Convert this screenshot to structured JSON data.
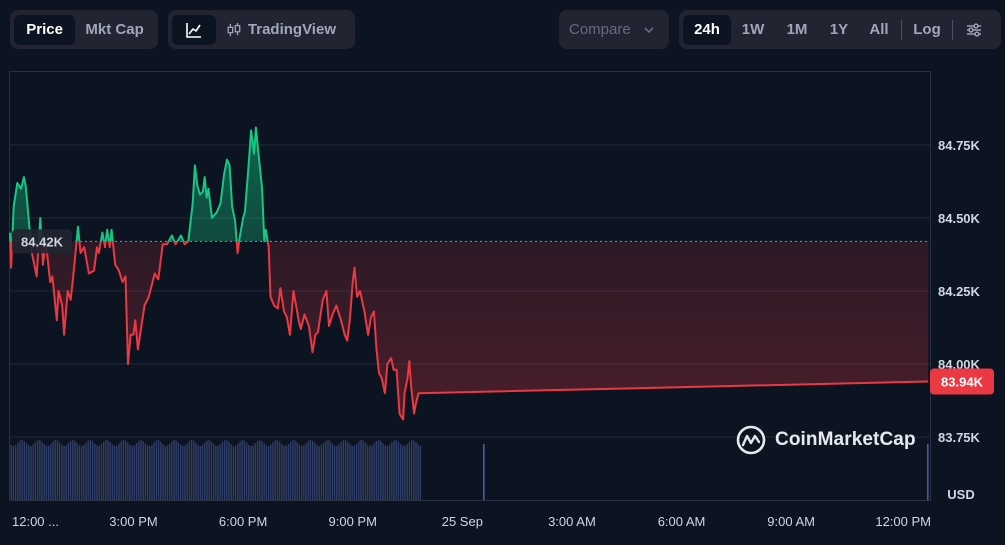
{
  "toolbar": {
    "metric_tabs": [
      {
        "label": "Price",
        "active": true
      },
      {
        "label": "Mkt Cap",
        "active": false
      }
    ],
    "view_tabs": {
      "line_icon": "line-chart-icon",
      "candles_icon": "candlestick-icon",
      "tradingview_label": "TradingView"
    },
    "compare_label": "Compare",
    "range_tabs": [
      {
        "label": "24h",
        "active": true
      },
      {
        "label": "1W",
        "active": false
      },
      {
        "label": "1M",
        "active": false
      },
      {
        "label": "1Y",
        "active": false
      },
      {
        "label": "All",
        "active": false
      }
    ],
    "log_label": "Log",
    "settings_icon": "sliders-icon"
  },
  "chart_data": {
    "type": "line",
    "reference_value": 84420,
    "reference_label": "84.42K",
    "last_value": 83940,
    "last_label": "83.94K",
    "currency_label": "USD",
    "y_ticks": [
      {
        "value": 84750,
        "label": "84.75K"
      },
      {
        "value": 84500,
        "label": "84.50K"
      },
      {
        "value": 84250,
        "label": "84.25K"
      },
      {
        "value": 84000,
        "label": "84.00K"
      },
      {
        "value": 83750,
        "label": "83.75K"
      }
    ],
    "ylim": [
      83750,
      85000
    ],
    "x_ticks": [
      {
        "t": 11.9,
        "label": "12:00 ..."
      },
      {
        "t": 15,
        "label": "3:00 PM"
      },
      {
        "t": 18,
        "label": "6:00 PM"
      },
      {
        "t": 21,
        "label": "9:00 PM"
      },
      {
        "t": 24,
        "label": "25 Sep"
      },
      {
        "t": 27,
        "label": "3:00 AM"
      },
      {
        "t": 30,
        "label": "6:00 AM"
      },
      {
        "t": 33,
        "label": "9:00 AM"
      },
      {
        "t": 36,
        "label": "12:00 PM"
      }
    ],
    "xlim": [
      11.62,
      36.8
    ],
    "up_color": "#16c784",
    "down_color": "#ea3943",
    "points": [
      [
        11.62,
        84450
      ],
      [
        11.65,
        84330
      ],
      [
        11.72,
        84540
      ],
      [
        11.82,
        84620
      ],
      [
        11.92,
        84600
      ],
      [
        12.0,
        84640
      ],
      [
        12.05,
        84610
      ],
      [
        12.15,
        84470
      ],
      [
        12.22,
        84380
      ],
      [
        12.35,
        84300
      ],
      [
        12.45,
        84500
      ],
      [
        12.52,
        84340
      ],
      [
        12.6,
        84420
      ],
      [
        12.72,
        84280
      ],
      [
        12.78,
        84300
      ],
      [
        12.9,
        84150
      ],
      [
        12.95,
        84250
      ],
      [
        13.05,
        84200
      ],
      [
        13.1,
        84100
      ],
      [
        13.2,
        84250
      ],
      [
        13.28,
        84220
      ],
      [
        13.35,
        84300
      ],
      [
        13.48,
        84470
      ],
      [
        13.55,
        84380
      ],
      [
        13.65,
        84400
      ],
      [
        13.78,
        84310
      ],
      [
        13.92,
        84320
      ],
      [
        14.0,
        84400
      ],
      [
        14.05,
        84380
      ],
      [
        14.15,
        84450
      ],
      [
        14.22,
        84400
      ],
      [
        14.28,
        84460
      ],
      [
        14.35,
        84400
      ],
      [
        14.4,
        84460
      ],
      [
        14.5,
        84340
      ],
      [
        14.6,
        84320
      ],
      [
        14.7,
        84280
      ],
      [
        14.78,
        84300
      ],
      [
        14.85,
        84000
      ],
      [
        14.92,
        84100
      ],
      [
        15.0,
        84100
      ],
      [
        15.05,
        84150
      ],
      [
        15.12,
        84050
      ],
      [
        15.18,
        84100
      ],
      [
        15.3,
        84200
      ],
      [
        15.42,
        84230
      ],
      [
        15.58,
        84310
      ],
      [
        15.68,
        84290
      ],
      [
        15.8,
        84410
      ],
      [
        15.92,
        84410
      ],
      [
        16.05,
        84440
      ],
      [
        16.15,
        84410
      ],
      [
        16.3,
        84440
      ],
      [
        16.4,
        84410
      ],
      [
        16.5,
        84420
      ],
      [
        16.62,
        84550
      ],
      [
        16.68,
        84680
      ],
      [
        16.75,
        84610
      ],
      [
        16.82,
        84580
      ],
      [
        16.9,
        84590
      ],
      [
        16.95,
        84640
      ],
      [
        17.0,
        84570
      ],
      [
        17.05,
        84600
      ],
      [
        17.15,
        84500
      ],
      [
        17.28,
        84520
      ],
      [
        17.38,
        84550
      ],
      [
        17.48,
        84650
      ],
      [
        17.56,
        84700
      ],
      [
        17.63,
        84680
      ],
      [
        17.7,
        84540
      ],
      [
        17.78,
        84490
      ],
      [
        17.85,
        84380
      ],
      [
        17.9,
        84430
      ],
      [
        18.0,
        84500
      ],
      [
        18.05,
        84520
      ],
      [
        18.15,
        84680
      ],
      [
        18.22,
        84800
      ],
      [
        18.3,
        84720
      ],
      [
        18.35,
        84810
      ],
      [
        18.42,
        84720
      ],
      [
        18.52,
        84600
      ],
      [
        18.58,
        84420
      ],
      [
        18.62,
        84460
      ],
      [
        18.7,
        84400
      ],
      [
        18.75,
        84230
      ],
      [
        18.85,
        84200
      ],
      [
        18.95,
        84190
      ],
      [
        19.02,
        84260
      ],
      [
        19.12,
        84180
      ],
      [
        19.2,
        84160
      ],
      [
        19.28,
        84100
      ],
      [
        19.38,
        84250
      ],
      [
        19.45,
        84200
      ],
      [
        19.52,
        84150
      ],
      [
        19.58,
        84120
      ],
      [
        19.68,
        84170
      ],
      [
        19.8,
        84130
      ],
      [
        19.9,
        84040
      ],
      [
        19.98,
        84100
      ],
      [
        20.05,
        84110
      ],
      [
        20.18,
        84220
      ],
      [
        20.28,
        84250
      ],
      [
        20.35,
        84130
      ],
      [
        20.45,
        84170
      ],
      [
        20.55,
        84200
      ],
      [
        20.68,
        84150
      ],
      [
        20.78,
        84100
      ],
      [
        20.85,
        84080
      ],
      [
        20.92,
        84150
      ],
      [
        21.0,
        84280
      ],
      [
        21.05,
        84330
      ],
      [
        21.12,
        84230
      ],
      [
        21.2,
        84250
      ],
      [
        21.32,
        84180
      ],
      [
        21.42,
        84100
      ],
      [
        21.5,
        84160
      ],
      [
        21.58,
        84180
      ],
      [
        21.65,
        84050
      ],
      [
        21.72,
        83970
      ],
      [
        21.8,
        83950
      ],
      [
        21.88,
        83900
      ],
      [
        21.95,
        84000
      ],
      [
        22.05,
        84020
      ],
      [
        22.12,
        83980
      ],
      [
        22.2,
        83980
      ],
      [
        22.28,
        83830
      ],
      [
        22.38,
        83810
      ],
      [
        22.42,
        83900
      ],
      [
        22.5,
        83950
      ],
      [
        22.55,
        84010
      ],
      [
        22.6,
        83920
      ],
      [
        22.68,
        83830
      ],
      [
        22.72,
        83860
      ],
      [
        22.8,
        83900
      ],
      [
        36.75,
        83940
      ]
    ]
  }
}
